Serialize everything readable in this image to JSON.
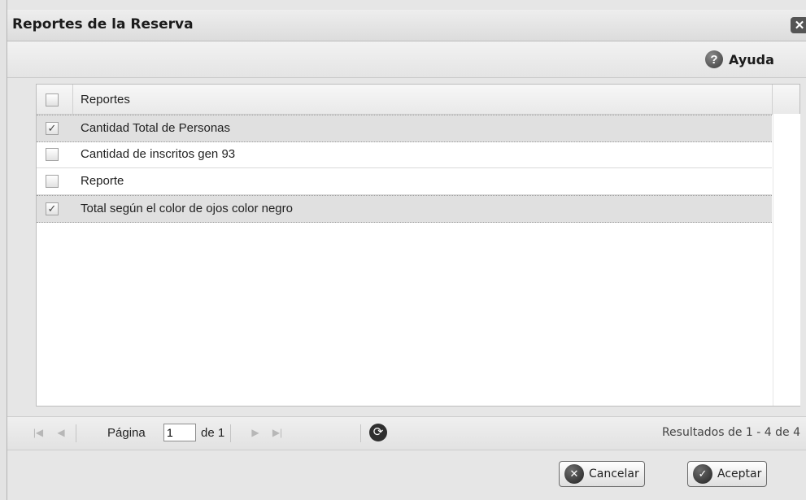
{
  "window": {
    "title": "Reportes de la Reserva",
    "close_glyph": "✕"
  },
  "toolbar": {
    "help_label": "Ayuda",
    "help_icon": "help-icon"
  },
  "grid": {
    "header_label": "Reportes",
    "rows": [
      {
        "label": "Cantidad Total de Personas",
        "checked": true
      },
      {
        "label": "Cantidad de inscritos gen 93",
        "checked": false
      },
      {
        "label": "Reporte",
        "checked": false
      },
      {
        "label": "Total según el color de ojos color negro",
        "checked": true
      }
    ]
  },
  "pager": {
    "page_label": "Página",
    "page_value": "1",
    "of_label": "de 1",
    "results_text": "Resultados de 1 - 4 de 4"
  },
  "footer": {
    "cancel_label": "Cancelar",
    "accept_label": "Aceptar"
  },
  "colors": {
    "accent": "#4a4a4a",
    "selected_row": "#e0e0e0"
  }
}
